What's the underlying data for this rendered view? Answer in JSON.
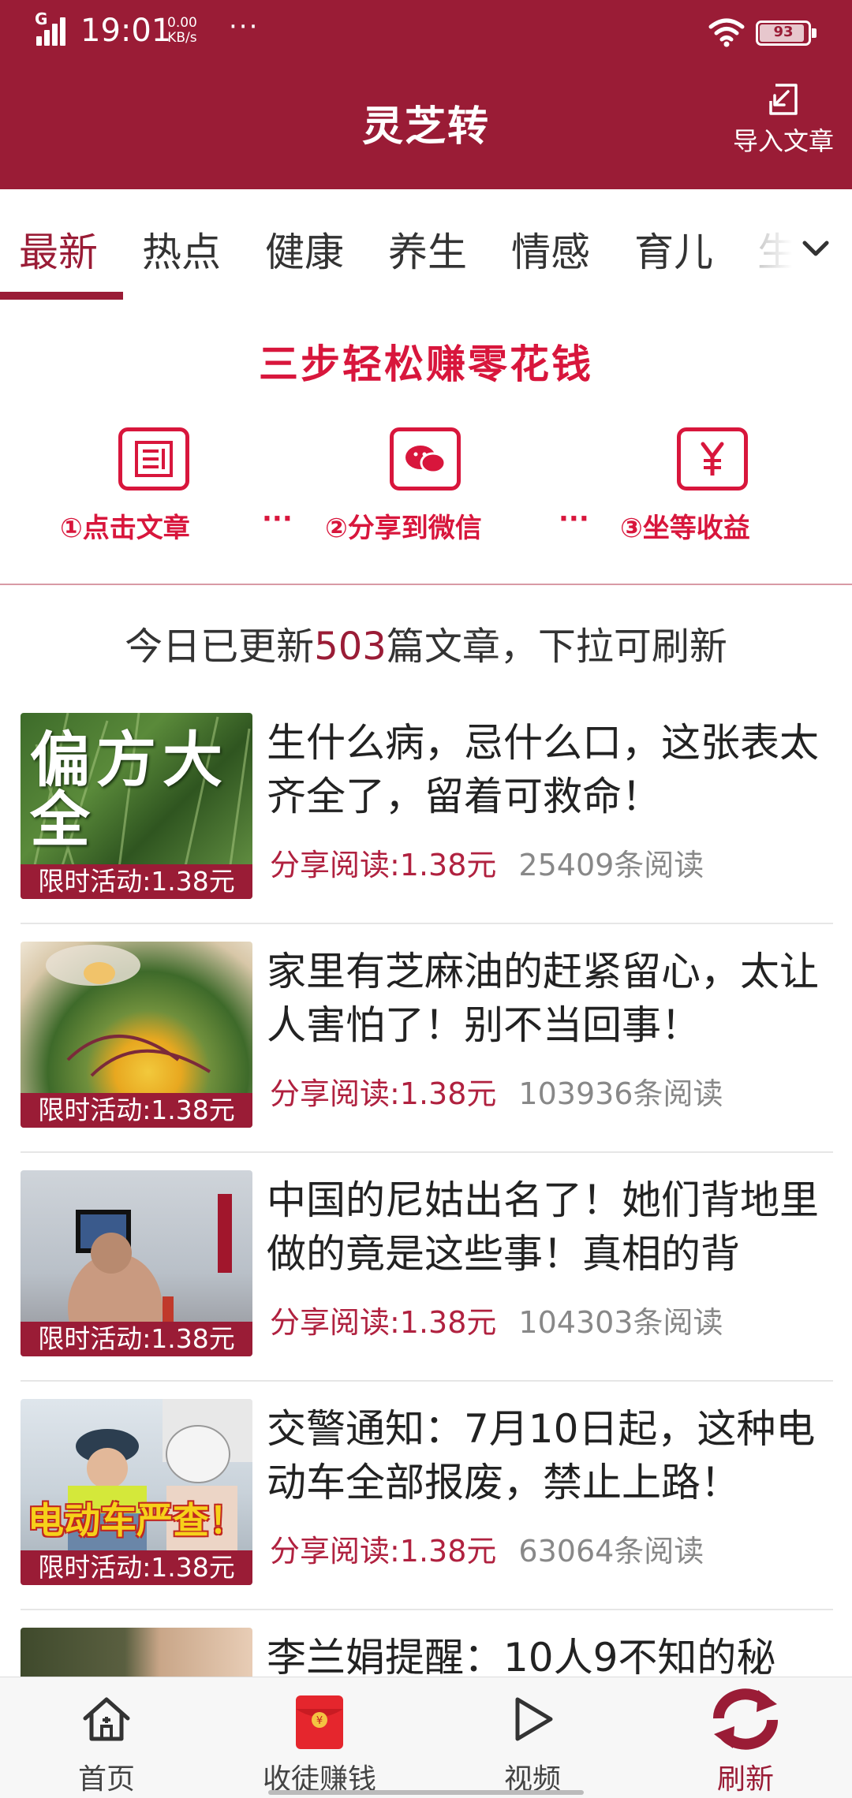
{
  "status_bar": {
    "network_type": "G",
    "time": "19:01",
    "speed_value": "0.00",
    "speed_unit": "KB/s",
    "more": "···",
    "battery": "93",
    "battery_level": 0.93
  },
  "header": {
    "title": "灵芝转",
    "import_label": "导入文章",
    "import_icon": "import-icon"
  },
  "tabs": [
    {
      "label": "最新",
      "active": true
    },
    {
      "label": "热点"
    },
    {
      "label": "健康"
    },
    {
      "label": "养生"
    },
    {
      "label": "情感"
    },
    {
      "label": "育儿"
    },
    {
      "label": "生"
    }
  ],
  "banner": {
    "title": "三步轻松赚零花钱",
    "steps": [
      {
        "icon": "article-icon",
        "label": "①点击文章"
      },
      {
        "icon": "wechat-icon",
        "label": "②分享到微信"
      },
      {
        "icon": "yuan-icon",
        "label": "③坐等收益"
      }
    ],
    "separator": "···"
  },
  "update": {
    "prefix": "今日已更新",
    "count": "503",
    "suffix": "篇文章，下拉可刷新"
  },
  "articles": [
    {
      "title": "生什么病，忌什么口，这张表太齐全了，留着可救命！",
      "badge": "限时活动:1.38元",
      "share": "分享阅读:1.38元",
      "reads": "25409条阅读",
      "thumb_text": "偏方大全"
    },
    {
      "title": "家里有芝麻油的赶紧留心，太让人害怕了！别不当回事！",
      "badge": "限时活动:1.38元",
      "share": "分享阅读:1.38元",
      "reads": "103936条阅读"
    },
    {
      "title": "中国的尼姑出名了！她们背地里做的竟是这些事！真相的背",
      "badge": "限时活动:1.38元",
      "share": "分享阅读:1.38元",
      "reads": "104303条阅读"
    },
    {
      "title": "交警通知：7月10日起，这种电动车全部报废，禁止上路！",
      "badge": "限时活动:1.38元",
      "share": "分享阅读:1.38元",
      "reads": "63064条阅读",
      "thumb_text": "电动车严查！"
    },
    {
      "title": "李兰娟提醒：10人9不知的秘",
      "badge": "",
      "share": "",
      "reads": ""
    }
  ],
  "bottom_nav": [
    {
      "label": "首页",
      "icon": "home-icon"
    },
    {
      "label": "收徒赚钱",
      "icon": "red-envelope-icon"
    },
    {
      "label": "视频",
      "icon": "play-icon"
    },
    {
      "label": "刷新",
      "icon": "refresh-icon",
      "active": true
    }
  ],
  "colors": {
    "brand": "#9a1c36",
    "accent_red": "#d8163c",
    "read_count_gray": "#888888"
  }
}
